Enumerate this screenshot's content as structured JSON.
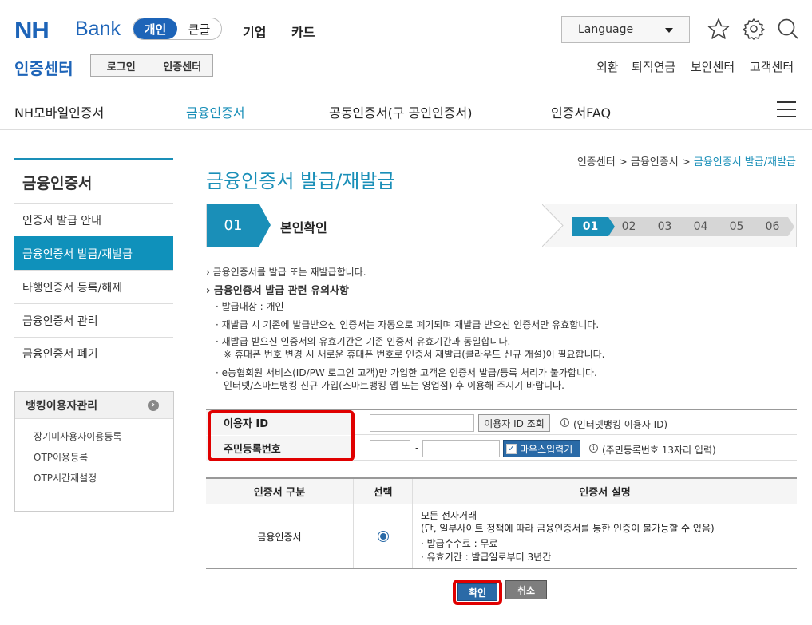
{
  "header": {
    "logo_nh": "NH",
    "logo_bank": "Bank",
    "mode_personal": "개인",
    "mode_large_font": "큰글",
    "nav_corporate": "기업",
    "nav_card": "카드",
    "language": "Language"
  },
  "subheader": {
    "title": "인증센터",
    "login": "로그인",
    "cert_center": "인증센터",
    "links": [
      "외환",
      "퇴직연금",
      "보안센터",
      "고객센터"
    ]
  },
  "gnb": [
    "NH모바일인증서",
    "금융인증서",
    "공동인증서(구 공인인증서)",
    "인증서FAQ"
  ],
  "sidebar": {
    "title": "금융인증서",
    "items": [
      "인증서 발급 안내",
      "금융인증서 발급/재발급",
      "타행인증서 등록/해제",
      "금융인증서 관리",
      "금융인증서 폐기"
    ],
    "banking_title": "뱅킹이용자관리",
    "banking_items": [
      "장기미사용자이용등록",
      "OTP이용등록",
      "OTP시간재설정"
    ]
  },
  "breadcrumb": {
    "a": "인증센터",
    "sep": ">",
    "b": "금융인증서",
    "c": "금융인증서 발급/재발급"
  },
  "page_title": "금융인증서 발급/재발급",
  "stepbar": {
    "num": "01",
    "name": "본인확인",
    "steps": [
      "01",
      "02",
      "03",
      "04",
      "05",
      "06"
    ]
  },
  "notice": {
    "line1": "금융인증서를 발급 또는 재발급합니다.",
    "heading": "금융인증서 발급 관련 유의사항",
    "target": "발급대상 : 개인",
    "reissue": "재발급 시 기존에 발급받으신 인증서는 자동으로 폐기되며 재발급 받으신 인증서만 유효합니다.",
    "validity": "재발급 받으신 인증서의 유효기간은 기존 인증서 유효기간과 동일합니다.",
    "phone": "※ 휴대폰 번호 변경 시 새로운 휴대폰 번호로 인증서 재발급(클라우드 신규 개설)이 필요합니다.",
    "member1": "e농협회원 서비스(ID/PW 로그인 고객)만 가입한 고객은 인증서 발급/등록 처리가 불가합니다.",
    "member2": "인터넷/스마트뱅킹 신규 가입(스마트뱅킹 앱 또는 영업점) 후 이용해 주시기 바랍니다."
  },
  "form": {
    "user_id_label": "이용자 ID",
    "user_id_value": "",
    "lookup_button": "이용자 ID 조회",
    "user_id_hint": "(인터넷뱅킹 이용자 ID)",
    "rrn_label": "주민등록번호",
    "rrn_front": "",
    "rrn_back": "",
    "dash": "-",
    "mouse_input": "마우스입력기",
    "rrn_hint": "(주민등록번호 13자리 입력)",
    "info_glyph": "i"
  },
  "cert_table": {
    "headers": [
      "인증서 구분",
      "선택",
      "인증서 설명"
    ],
    "row_type": "금융인증서",
    "desc1": "모든 전자거래",
    "desc2": "(단, 일부사이트 정책에 따라 금융인증서를 통한 인증이 불가능할 수 있음)",
    "desc3": "· 발급수수료 : 무료",
    "desc4": "· 유효기간 : 발급일로부터 3년간"
  },
  "buttons": {
    "confirm": "확인",
    "cancel": "취소"
  },
  "colors": {
    "brand_blue": "#1d64b8",
    "accent_teal": "#1a8fb8",
    "highlight_red": "#e00000"
  }
}
